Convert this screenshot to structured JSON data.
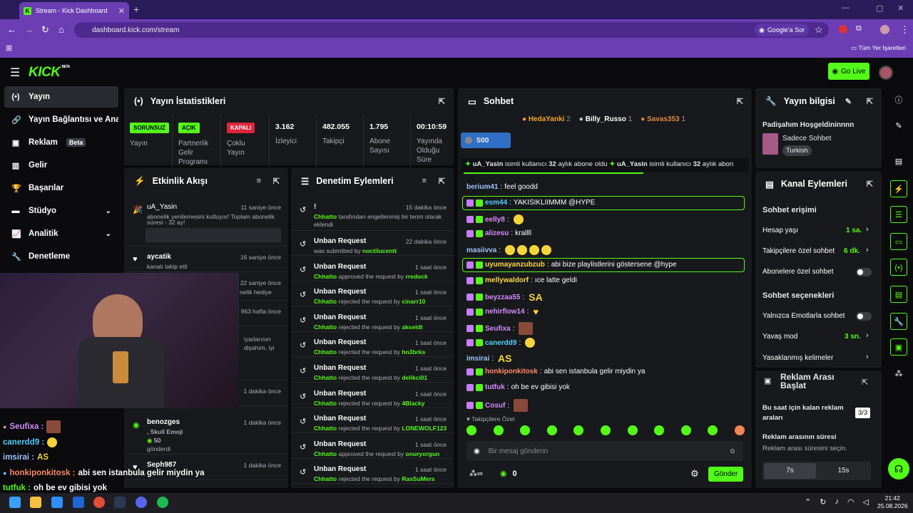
{
  "browser": {
    "tab_title": "Stream - Kick Dashboard",
    "url": "dashboard.kick.com/stream",
    "google_btn": "Google'a Sor",
    "bookmarks": "Tüm Yer İşaretleri"
  },
  "header": {
    "logo": "KICK",
    "beta": "BETA",
    "golive": "Go Live"
  },
  "sidebar": {
    "items": [
      {
        "label": "Yayın"
      },
      {
        "label": "Yayın Bağlantısı ve Anahtarı"
      },
      {
        "label": "Reklam",
        "badge": "Beta"
      },
      {
        "label": "Gelir"
      },
      {
        "label": "Başarılar"
      },
      {
        "label": "Stüdyo"
      },
      {
        "label": "Analitik"
      },
      {
        "label": "Denetleme"
      }
    ]
  },
  "stats": {
    "title": "Yayın İstatistikleri",
    "items": [
      {
        "pill": "SORUNSUZ",
        "label": "Yayın"
      },
      {
        "pill": "AÇIK",
        "label": "Partnerlik Gelir Programı"
      },
      {
        "pill": "KAPALI",
        "label": "Çoklu Yayın"
      },
      {
        "value": "3.162",
        "label": "İzleyici"
      },
      {
        "value": "482.055",
        "label": "Takipçi"
      },
      {
        "value": "1.795",
        "label": "Abone Sayısı"
      },
      {
        "value": "00:10:59",
        "label": "Yayında Olduğu Süre"
      }
    ]
  },
  "activity": {
    "title": "Etkinlik Akışı",
    "rows": [
      {
        "user": "uA_Yasin",
        "time": "11 saniye önce",
        "desc1": "abonelik yenilemesini kutluyor! Toplam abonelik",
        "desc2": "süresi - 32 ay!"
      },
      {
        "user": "aycatik",
        "time": "16 saniye önce",
        "desc": "kanalı takip etti"
      },
      {
        "time": "22 saniye önce",
        "desc": "nelik hediye"
      },
      {
        "time": "963 hafta önce"
      },
      {
        "desc1": "iyarlarının",
        "desc2": "dişahım, iyi"
      },
      {
        "time": "1 dakika önce"
      },
      {
        "user": "benozges",
        "time": "1 dakika önce",
        "desc": ", Skull Emoji",
        "amount": "50",
        "desc2": "gönderdi"
      },
      {
        "user": "Seph987",
        "time": "1 dakika önce"
      }
    ]
  },
  "moderation": {
    "title": "Denetim Eylemleri",
    "rows": [
      {
        "title": "!",
        "time": "15 dakika önce",
        "actor": "Chhatto",
        "desc": "tarafından engellenmiş bir terim olarak",
        "desc2": "eklendi"
      },
      {
        "title": "Unban Request",
        "time": "22 dakika önce",
        "actor": "",
        "desc": "was submitted by",
        "target": "noctilucentt"
      },
      {
        "title": "Unban Request",
        "time": "1 saat önce",
        "actor": "Chhatto",
        "desc": "approved the request by",
        "target": "rredock"
      },
      {
        "title": "Unban Request",
        "time": "1 saat önce",
        "actor": "Chhatto",
        "desc": "rejected the request by",
        "target": "cinarr10"
      },
      {
        "title": "Unban Request",
        "time": "1 saat önce",
        "actor": "Chhatto",
        "desc": "rejected the request by",
        "target": "akseldt"
      },
      {
        "title": "Unban Request",
        "time": "1 saat önce",
        "actor": "Chhatto",
        "desc": "rejected the request by",
        "target": "hn3brks"
      },
      {
        "title": "Unban Request",
        "time": "1 saat önce",
        "actor": "Chhatto",
        "desc": "rejected the request by",
        "target": "delikci01"
      },
      {
        "title": "Unban Request",
        "time": "1 saat önce",
        "actor": "Chhatto",
        "desc": "rejected the request by",
        "target": "4Blacky"
      },
      {
        "title": "Unban Request",
        "time": "1 saat önce",
        "actor": "Chhatto",
        "desc": "rejected the request by",
        "target": "LONEWOLF123"
      },
      {
        "title": "Unban Request",
        "time": "1 saat önce",
        "actor": "Chhatto",
        "desc": "approved the request by",
        "target": "onuryorgun"
      },
      {
        "title": "Unban Request",
        "time": "1 saat önce",
        "actor": "Chhatto",
        "desc": "rejected the request by",
        "target": "RasSuMers"
      }
    ]
  },
  "chat": {
    "title": "Sohbet",
    "top": [
      {
        "name": "HedaYanki",
        "n": "2"
      },
      {
        "name": "Billy_Russo",
        "n": "1"
      },
      {
        "name": "Savas353",
        "n": "1"
      }
    ],
    "goal": "500",
    "ticker": "uA_Yasin isimli kullanıcı 32 aylık abone oldu",
    "ticker_b1": "uA_Yasin",
    "ticker_b2": "32",
    "ticker_u1": " isimli kullanıcı ",
    "ticker_u2": " aylık abone oldu",
    "ticker_b3": "uA_Yasin",
    "ticker_u3": " isimli kullanıcı ",
    "ticker_b4": "32",
    "ticker_u4": " aylık abon",
    "lines": [
      {
        "user": "berium41",
        "color": "#9fc3ff",
        "msg": "feel goodd"
      },
      {
        "user": "esm44",
        "color": "#4fd0ff",
        "msg": "YAKISIKLIIMMM @HYPE"
      },
      {
        "user": "eelly8",
        "color": "#d58cff",
        "msg": ""
      },
      {
        "user": "alizesu",
        "color": "#d58cff",
        "msg": "krallll"
      },
      {
        "user": "masiivva",
        "color": "#9fc3ff",
        "msg": ""
      },
      {
        "user": "uyumayanzubzub",
        "color": "#ffd84a",
        "msg": "abi bize playlistlerini göstersene @hype"
      },
      {
        "user": "mellywaldorf",
        "color": "#ffd84a",
        "msg": "ıce latte geldi"
      },
      {
        "user": "beyzzaa55",
        "color": "#d58cff",
        "msg": ""
      },
      {
        "user": "nehirflow14",
        "color": "#d58cff",
        "msg": ""
      },
      {
        "user": "Seufixa",
        "color": "#d58cff",
        "msg": ""
      },
      {
        "user": "canerdd9",
        "color": "#4fd0ff",
        "msg": ""
      },
      {
        "user": "imsirai",
        "color": "#9fc3ff",
        "msg": ""
      },
      {
        "user": "honkiponkitosk",
        "color": "#ff8a65",
        "msg": "abi sen istanbula gelir miydin ya"
      },
      {
        "user": "tutfuk",
        "color": "#d58cff",
        "msg": "oh be ev gibisi yok"
      },
      {
        "user": "Cosuf",
        "color": "#d58cff",
        "msg": ""
      }
    ],
    "followers_only": "Takipçilere Özel",
    "placeholder": "Bir mesaj gönderin",
    "send": "Gönder",
    "count": "0"
  },
  "info": {
    "title": "Yayın bilgisi",
    "stream_title": "Padişahım Hoşgeldininnnn",
    "category": "Sadece Sohbet",
    "lang": "Turkish"
  },
  "channel": {
    "title": "Kanal Eylemleri",
    "chat_access": "Sohbet erişimi",
    "account_age": "Hesap yaşı",
    "account_age_v": "1 sa.",
    "followers": "Takipçilere özel sohbet",
    "followers_v": "6 dk.",
    "subs": "Abonelere özel sohbet",
    "options": "Sohbet seçenekleri",
    "emotes": "Yalnızca Emotlarla sohbet",
    "slow": "Yavaş mod",
    "slow_v": "3 sn.",
    "banned": "Yasaklanmış kelimeler"
  },
  "ads": {
    "title": "Reklam Arası Başlat",
    "remaining": "Bu saat için kalan reklam araları",
    "remaining_v": "3/3",
    "duration": "Reklam arasının süresi",
    "duration_hint": "Reklam arası süresini seçin.",
    "opt1": "7s",
    "opt2": "15s"
  },
  "overlay": [
    {
      "user": "Seufixa :"
    },
    {
      "user": "canerdd9 :"
    },
    {
      "user": "imsirai :"
    },
    {
      "user": "honkiponkitosk :",
      "msg": "abi sen istanbula gelir miydin ya"
    },
    {
      "user": "tutfuk :",
      "msg": "oh be ev gibisi yok"
    }
  ],
  "clock": {
    "time": "21:42",
    "date": "25.08.2026"
  }
}
